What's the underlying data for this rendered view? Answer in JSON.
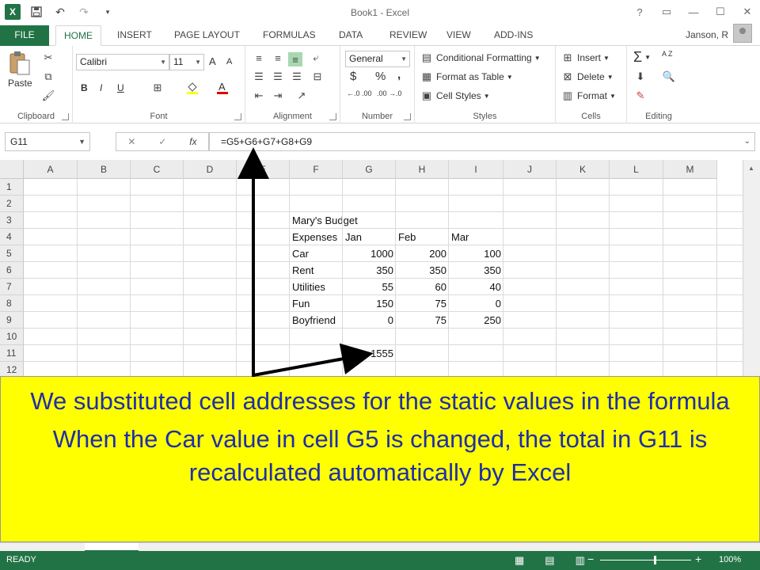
{
  "window": {
    "title": "Book1 - Excel",
    "user": "Janson, R"
  },
  "qat": {
    "excel_icon": "X",
    "save_icon": "save-icon",
    "undo_icon": "undo-icon",
    "redo_icon": "redo-icon"
  },
  "titlebar_buttons": {
    "help": "?",
    "restore_ribbon": "▭",
    "minimize": "—",
    "maximize": "☐",
    "close": "✕"
  },
  "tabs": [
    {
      "label": "FILE"
    },
    {
      "label": "HOME"
    },
    {
      "label": "INSERT"
    },
    {
      "label": "PAGE LAYOUT"
    },
    {
      "label": "FORMULAS"
    },
    {
      "label": "DATA"
    },
    {
      "label": "REVIEW"
    },
    {
      "label": "VIEW"
    },
    {
      "label": "ADD-INS"
    }
  ],
  "ribbon": {
    "clipboard": {
      "label": "Clipboard",
      "paste": "Paste"
    },
    "font": {
      "label": "Font",
      "name": "Calibri",
      "size": "11",
      "bold": "B",
      "italic": "I",
      "underline": "U",
      "grow": "A",
      "shrink": "A"
    },
    "alignment": {
      "label": "Alignment"
    },
    "number": {
      "label": "Number",
      "format": "General",
      "currency": "$",
      "percent": "%",
      "comma": ",",
      "inc_dec": "←.0 .00",
      "dec_dec": ".00 →.0"
    },
    "styles": {
      "label": "Styles",
      "conditional": "Conditional Formatting",
      "format_table": "Format as Table",
      "cell_styles": "Cell Styles"
    },
    "cells": {
      "label": "Cells",
      "insert": "Insert",
      "delete": "Delete",
      "format": "Format"
    },
    "editing": {
      "label": "Editing",
      "sum": "Σ",
      "sort": "A Z"
    }
  },
  "formula_bar": {
    "name_box": "G11",
    "cancel": "✕",
    "enter": "✓",
    "fx": "fx",
    "formula": "=G5+G6+G7+G8+G9"
  },
  "columns": [
    "A",
    "B",
    "C",
    "D",
    "E",
    "F",
    "G",
    "H",
    "I",
    "J",
    "K",
    "L",
    "M"
  ],
  "rows": [
    "1",
    "2",
    "3",
    "4",
    "5",
    "6",
    "7",
    "8",
    "9",
    "10",
    "11",
    "12"
  ],
  "sheet": {
    "title": "Mary's Budget",
    "header": {
      "label": "Expenses",
      "months": [
        "Jan",
        "Feb",
        "Mar"
      ]
    },
    "expenses": [
      {
        "name": "Car",
        "values": [
          "1000",
          "200",
          "100"
        ]
      },
      {
        "name": "Rent",
        "values": [
          "350",
          "350",
          "350"
        ]
      },
      {
        "name": "Utilities",
        "values": [
          "55",
          "60",
          "40"
        ]
      },
      {
        "name": "Fun",
        "values": [
          "150",
          "75",
          "0"
        ]
      },
      {
        "name": "Boyfriend",
        "values": [
          "0",
          "75",
          "250"
        ]
      }
    ],
    "total": "1555"
  },
  "callout": {
    "line1": "We substituted cell addresses for the static values in the formula",
    "line2": "When the Car value in cell G5 is changed, the total in G11 is recalculated automatically by Excel",
    "background": "#ffff00",
    "text_color": "#1f2fa8"
  },
  "status": {
    "ready": "READY",
    "zoom_minus": "−",
    "zoom_plus": "+",
    "zoom": "100%"
  },
  "colors": {
    "accent": "#217346"
  }
}
